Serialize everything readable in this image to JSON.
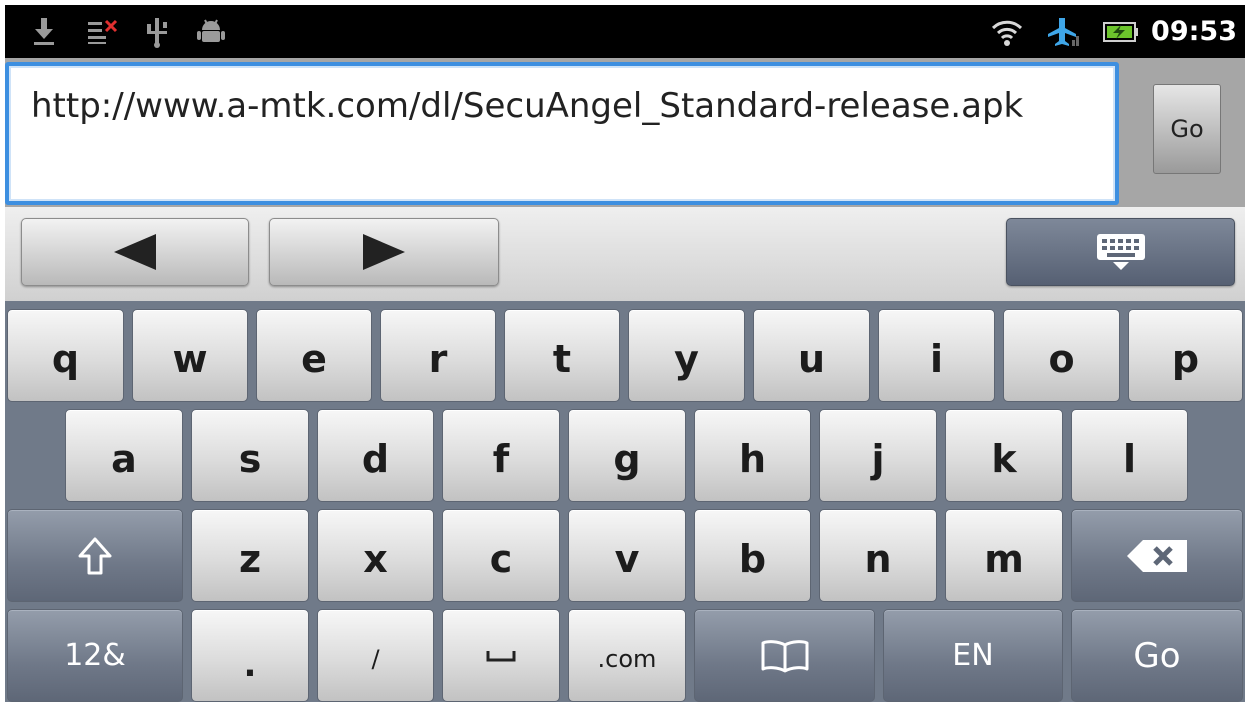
{
  "status_bar": {
    "icons": [
      "download-icon",
      "sync-error-icon",
      "usb-icon",
      "android-debug-icon"
    ],
    "right_icons": [
      "wifi-icon",
      "airplane-mode-icon",
      "battery-charging-icon"
    ],
    "time": "09:53"
  },
  "url_bar": {
    "value": "http://www.a-mtk.com/dl/SecuAngel_Standard-release.apk",
    "go_label": "Go"
  },
  "nav_strip": {
    "left_icon": "arrow-left-icon",
    "right_icon": "arrow-right-icon",
    "hide_icon": "keyboard-hide-icon"
  },
  "keyboard": {
    "row1": [
      "q",
      "w",
      "e",
      "r",
      "t",
      "y",
      "u",
      "i",
      "o",
      "p"
    ],
    "row2": [
      "a",
      "s",
      "d",
      "f",
      "g",
      "h",
      "j",
      "k",
      "l"
    ],
    "row3": [
      "z",
      "x",
      "c",
      "v",
      "b",
      "n",
      "m"
    ],
    "shift_icon": "shift-icon",
    "backspace_icon": "backspace-icon",
    "symbols_label": "12&",
    "period_label": ".",
    "slash_label": "/",
    "space_icon": "space-icon",
    "dotcom_label": ".com",
    "dictionary_icon": "book-icon",
    "language_label": "EN",
    "go_label": "Go"
  },
  "colors": {
    "accent": "#3d8fe0",
    "keyboard_bg": "#707a89",
    "status_bar_bg": "#000000"
  }
}
